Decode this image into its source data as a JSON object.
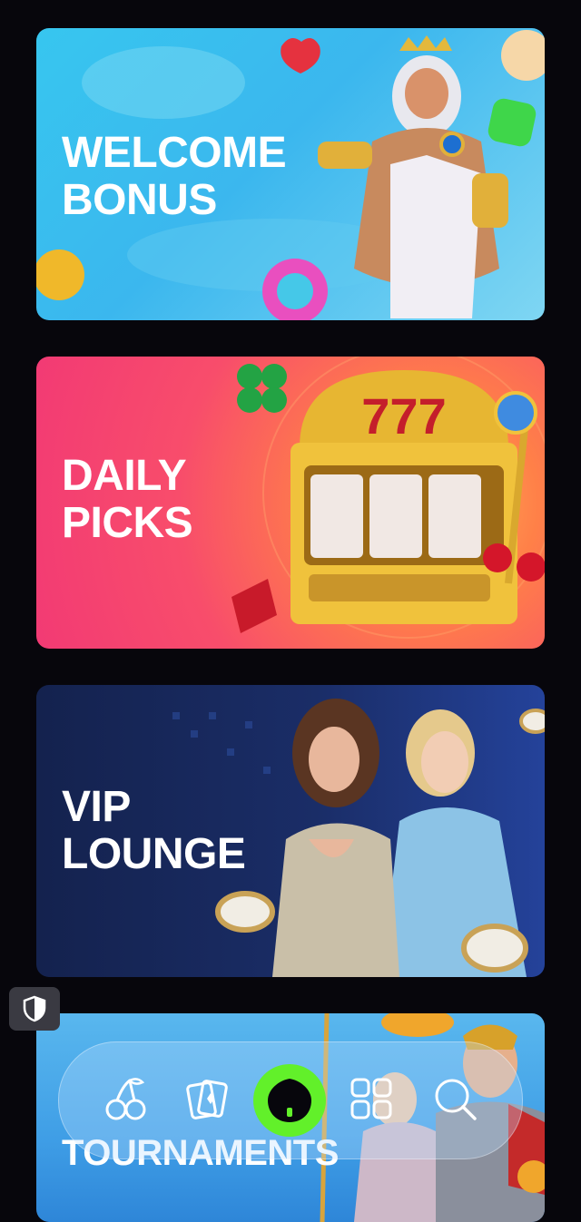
{
  "promos": [
    {
      "title_line1": "WELCOME",
      "title_line2": "BONUS"
    },
    {
      "title_line1": "DAILY",
      "title_line2": "PICKS"
    },
    {
      "title_line1": "VIP",
      "title_line2": "LOUNGE"
    },
    {
      "title_line1": "TOURNAMENTS"
    }
  ],
  "nav": {
    "items": [
      {
        "icon": "cherries-icon"
      },
      {
        "icon": "cards-icon"
      },
      {
        "icon": "home-icon",
        "active": true
      },
      {
        "icon": "grid-icon"
      },
      {
        "icon": "search-icon"
      }
    ],
    "accent": "#62f02a"
  },
  "privacy": {
    "icon": "shield-icon"
  },
  "colors": {
    "background": "#07060c",
    "welcome": "#3bb7ee",
    "daily": "#f84d6b",
    "vip": "#1a2d67",
    "tournaments": "#3f9ee6"
  }
}
